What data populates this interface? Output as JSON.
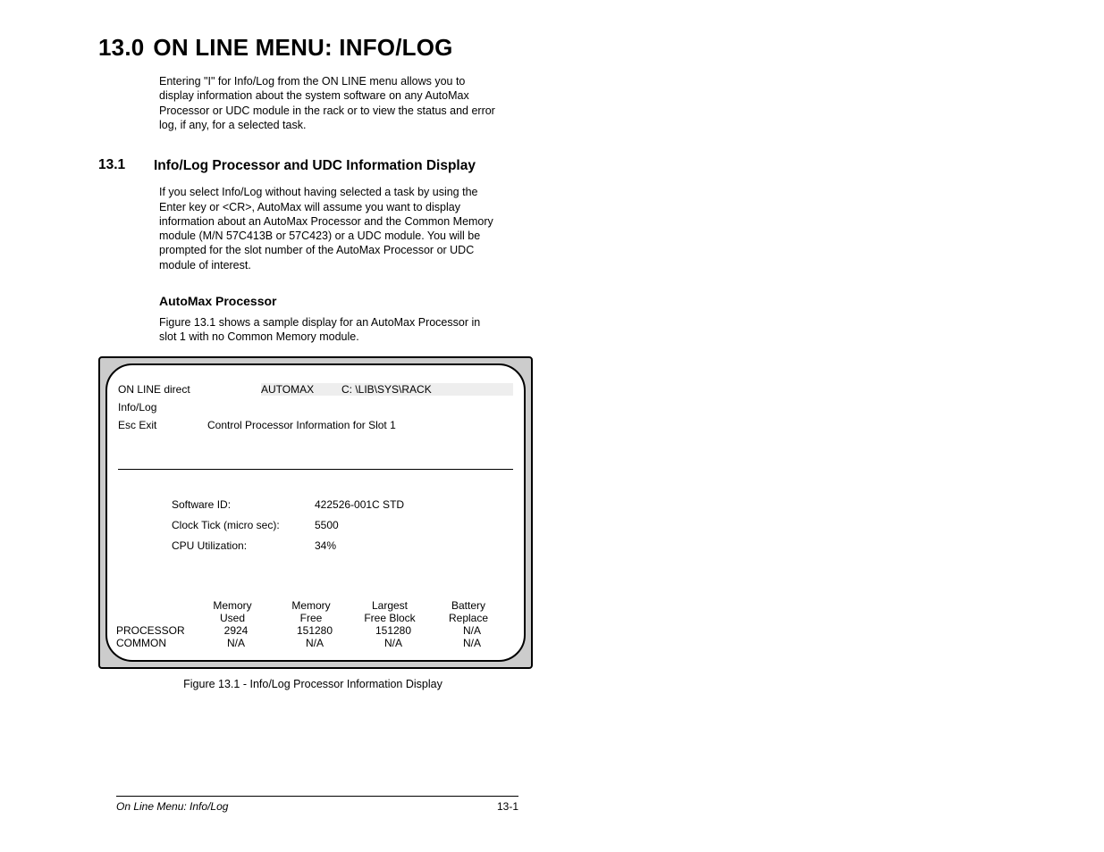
{
  "chapter": {
    "number": "13.0",
    "title": "ON LINE MENU: INFO/LOG"
  },
  "intro": "Entering \"I\" for Info/Log from the ON LINE menu allows you to display information about the system software on any AutoMax Processor or UDC module in the rack or to view the status and error log, if any, for a selected task.",
  "section": {
    "number": "13.1",
    "title": "Info/Log Processor and UDC Information Display",
    "body": "If you select Info/Log without having selected a task by using the Enter key or <CR>, AutoMax will assume you want to display information about an AutoMax Processor and the Common Memory module (M/N 57C413B or 57C423) or a UDC module. You will be prompted for the slot number of the AutoMax Processor or UDC module of interest."
  },
  "subhead": "AutoMax Processor",
  "subhead_body": "Figure 13.1 shows a sample display for an AutoMax Processor in slot 1 with no Common Memory module.",
  "screen": {
    "top_left": "ON LINE direct",
    "top_mid": "AUTOMAX",
    "top_right": "C: \\LIB\\SYS\\RACK",
    "sub1": "Info/Log",
    "esc": "Esc  Exit",
    "sub2_title": "Control Processor Information for Slot 1",
    "info": {
      "sw_id_label": "Software ID:",
      "sw_id_value": "422526-001C STD",
      "clk_label": "Clock Tick (micro sec):",
      "clk_value": "5500",
      "cpu_label": "CPU Utilization:",
      "cpu_value": "34%"
    },
    "table": {
      "headers": [
        "",
        "Memory\nUsed",
        "Memory\nFree",
        "Largest\nFree Block",
        "Battery\nReplace"
      ],
      "rows": [
        {
          "label": "PROCESSOR",
          "values": [
            "2924",
            "151280",
            "151280",
            "N/A"
          ]
        },
        {
          "label": "COMMON",
          "values": [
            "N/A",
            "N/A",
            "N/A",
            "N/A"
          ]
        }
      ]
    }
  },
  "figure_caption": "Figure 13.1 - Info/Log Processor Information Display",
  "footer": {
    "title": "On Line Menu: Info/Log",
    "page": "13-1"
  }
}
